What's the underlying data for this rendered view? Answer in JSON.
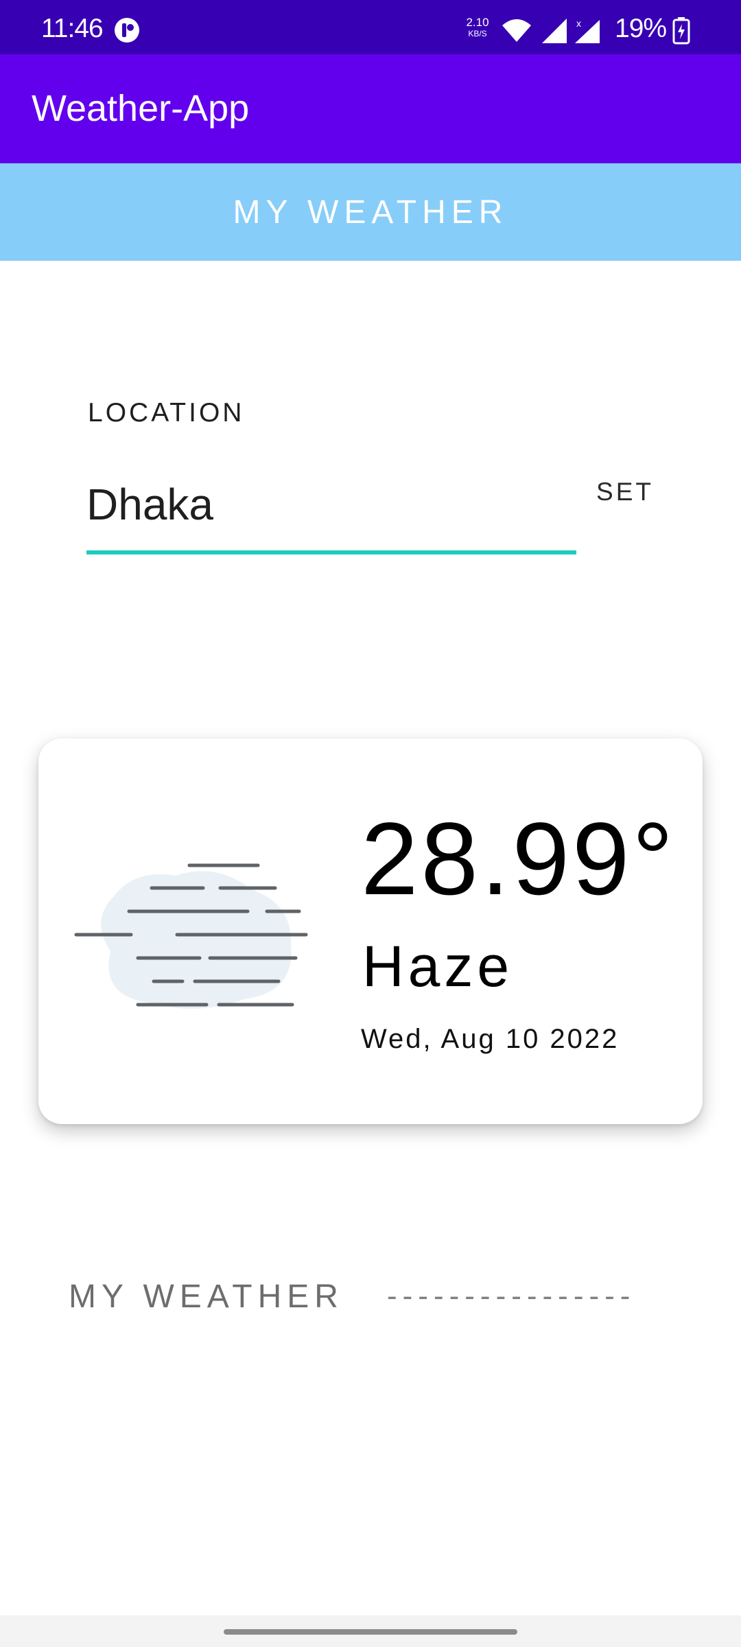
{
  "status_bar": {
    "time": "11:46",
    "speed_value": "2.10",
    "speed_unit": "KB/S",
    "battery": "19%"
  },
  "app_bar": {
    "title": "Weather-App"
  },
  "tab": {
    "label": "MY WEATHER"
  },
  "location": {
    "label": "LOCATION",
    "value": "Dhaka",
    "set_label": "SET",
    "underline_color": "#1ecbbf"
  },
  "weather": {
    "icon": "haze-icon",
    "temperature": "28.99°",
    "condition": "Haze",
    "date": "Wed, Aug 10 2022"
  },
  "footer": {
    "label": "MY WEATHER",
    "dashes": "----------------"
  },
  "colors": {
    "status_bar": "#3700b3",
    "app_bar": "#6200ee",
    "tab_strip": "#87cdf9"
  }
}
